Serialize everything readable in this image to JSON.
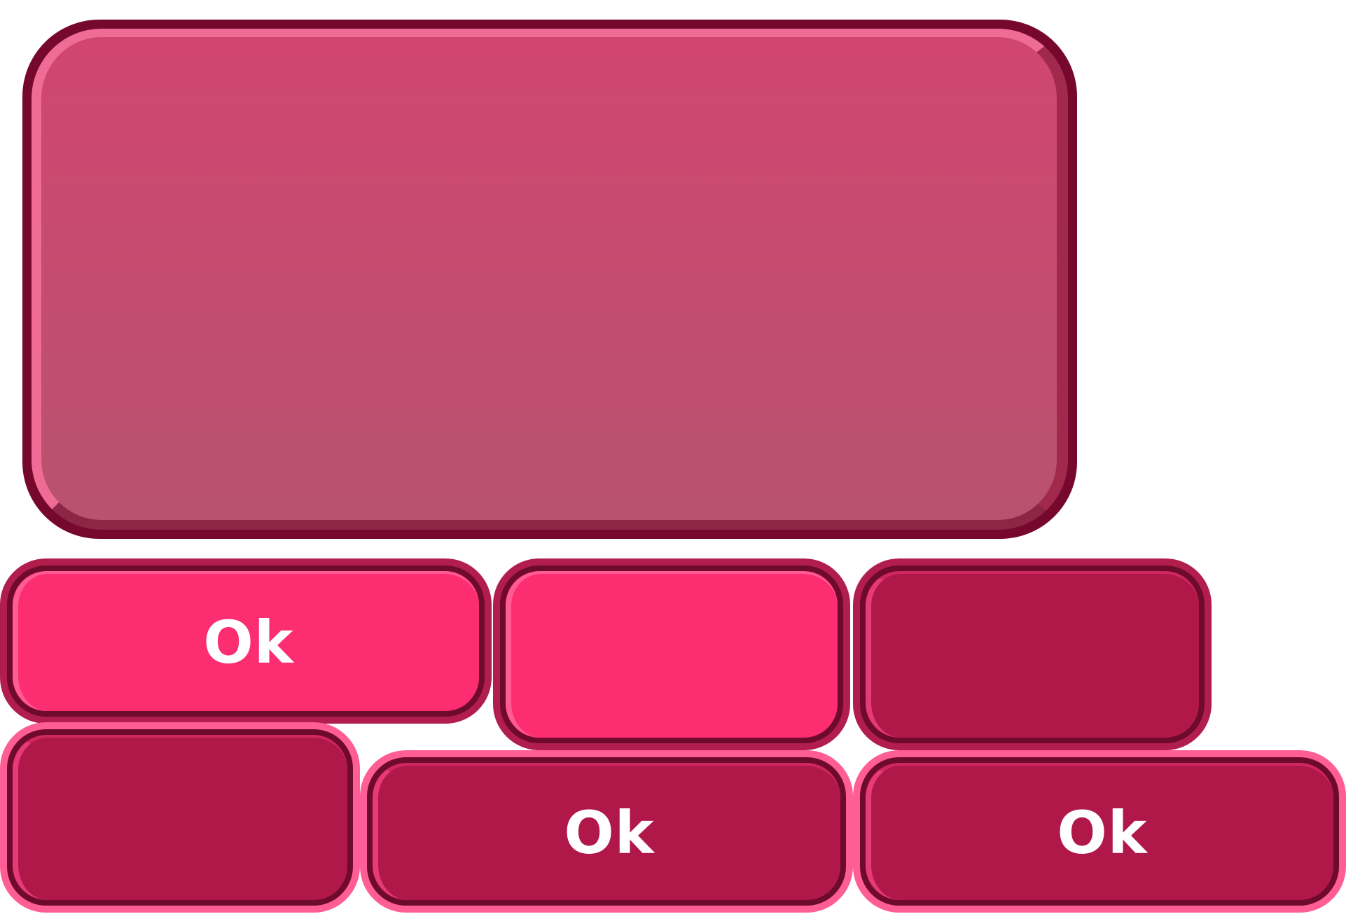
{
  "colors": {
    "panel_frame": "#76082e",
    "panel_fill_top": "#d14671",
    "panel_fill_bottom": "#b8526f",
    "button_bright": "#fc2d71",
    "button_deep": "#b1184a",
    "button_border": "#6e0a2c",
    "rim_dark": "#b11d4d",
    "rim_light": "#ff5d95",
    "label": "#ffffff"
  },
  "buttons": [
    {
      "label": "Ok",
      "style": "bright",
      "rim": "dark"
    },
    {
      "label": "",
      "style": "bright",
      "rim": "dark"
    },
    {
      "label": "",
      "style": "deep",
      "rim": "dark"
    },
    {
      "label": "",
      "style": "deep",
      "rim": "light"
    },
    {
      "label": "Ok",
      "style": "deep",
      "rim": "light"
    },
    {
      "label": "Ok",
      "style": "deep",
      "rim": "light"
    }
  ]
}
